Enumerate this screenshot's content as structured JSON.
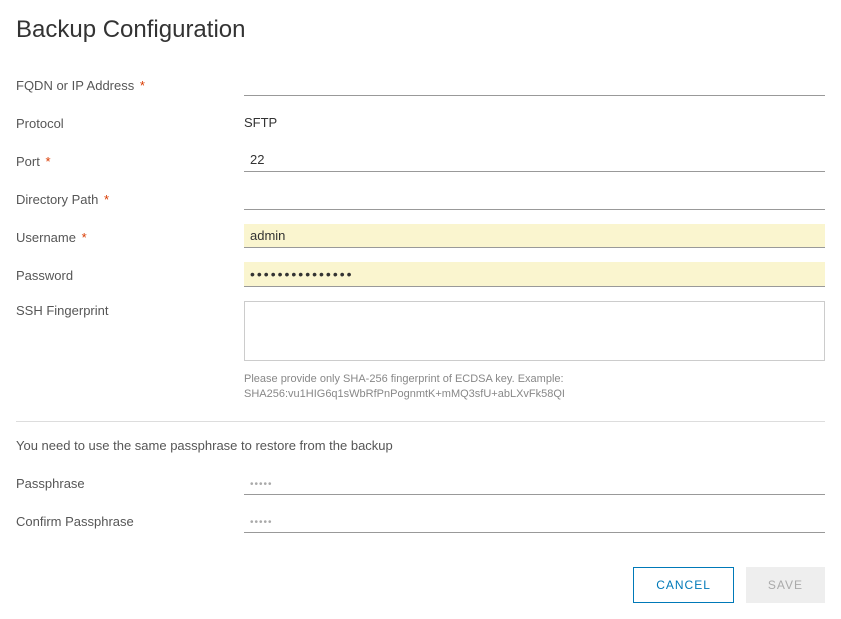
{
  "title": "Backup Configuration",
  "fields": {
    "fqdn": {
      "label": "FQDN or IP Address",
      "value": "",
      "required": true
    },
    "protocol": {
      "label": "Protocol",
      "value": "SFTP"
    },
    "port": {
      "label": "Port",
      "value": "22",
      "required": true
    },
    "directory": {
      "label": "Directory Path",
      "value": "",
      "required": true
    },
    "username": {
      "label": "Username",
      "value": "admin",
      "required": true
    },
    "password": {
      "label": "Password",
      "value": "•••••••••••••••"
    },
    "sshfingerprint": {
      "label": "SSH Fingerprint",
      "value": "",
      "hint": "Please provide only SHA-256 fingerprint of ECDSA key. Example: SHA256:vu1HIG6q1sWbRfPnPognmtK+mMQ3sfU+abLXvFk58QI"
    },
    "passphrase": {
      "label": "Passphrase",
      "placeholder": "•••••"
    },
    "confirm": {
      "label": "Confirm Passphrase",
      "placeholder": "•••••"
    }
  },
  "section_note": "You need to use the same passphrase to restore from the backup",
  "buttons": {
    "cancel": "CANCEL",
    "save": "SAVE"
  },
  "required_mark": "*"
}
